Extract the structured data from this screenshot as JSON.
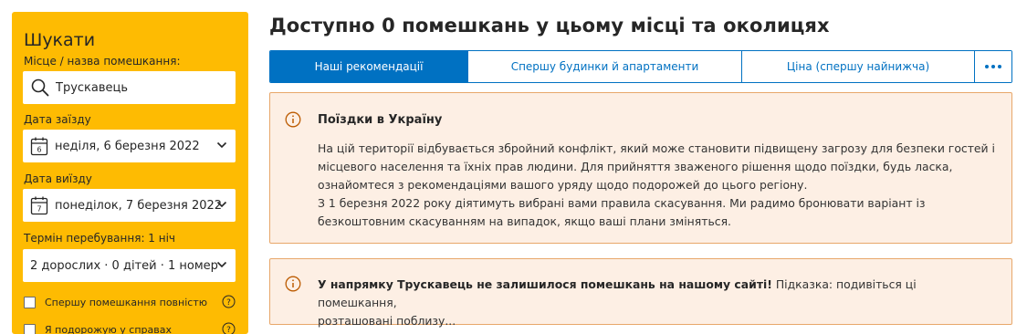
{
  "colors": {
    "sidebar_bg": "#febb02",
    "accent_blue": "#0071c2",
    "alert_bg": "#fdefe4",
    "alert_border": "#e8a76a"
  },
  "sidebar": {
    "title": "Шукати",
    "destination": {
      "label": "Місце / назва помешкання:",
      "value": "Трускавець",
      "icon": "search-icon"
    },
    "checkin": {
      "label": "Дата заїзду",
      "value": "неділя, 6 березня 2022",
      "calendar_day": "6"
    },
    "checkout": {
      "label": "Дата виїзду",
      "value": "понеділок, 7 березня 2022",
      "calendar_day": "7"
    },
    "stay_length": "Термін перебування: 1 ніч",
    "occupancy": "2 дорослих · 0 дітей · 1 номер",
    "checkboxes": [
      {
        "label": "Спершу помешкання повністю",
        "checked": false
      },
      {
        "label": "Я подорожую у справах",
        "checked": false
      }
    ]
  },
  "main": {
    "title": "Доступно 0 помешкань у цьому місці та околицях",
    "tabs": [
      {
        "label": "Наші рекомендації",
        "active": true
      },
      {
        "label": "Спершу будинки й апартаменти",
        "active": false
      },
      {
        "label": "Ціна (спершу найнижча)",
        "active": false
      }
    ],
    "more_icon": "ellipsis-icon"
  },
  "alert_travel": {
    "title": "Поїздки в Україну",
    "lines": [
      "На цій території відбувається збройний конфлікт, який може становити підвищену загрозу для безпеки гостей і",
      "місцевого населення та їхніх прав людини. Для прийняття зваженого рішення щодо поїздки, будь ласка,",
      "ознайомтеся з рекомендаціями вашого уряду щодо подорожей до цього регіону.",
      "З 1 березня 2022 року діятимуть вибрані вами правила скасування. Ми радимо бронювати варіант із",
      "безкоштовним скасуванням на випадок, якщо ваші плани зміняться."
    ]
  },
  "alert_none": {
    "bold": "У напрямку Трускавець не залишилося помешкань на нашому сайті!",
    "hint": " Підказка: подивіться ці помешкання,",
    "hint_line2": "розташовані поблизу..."
  }
}
